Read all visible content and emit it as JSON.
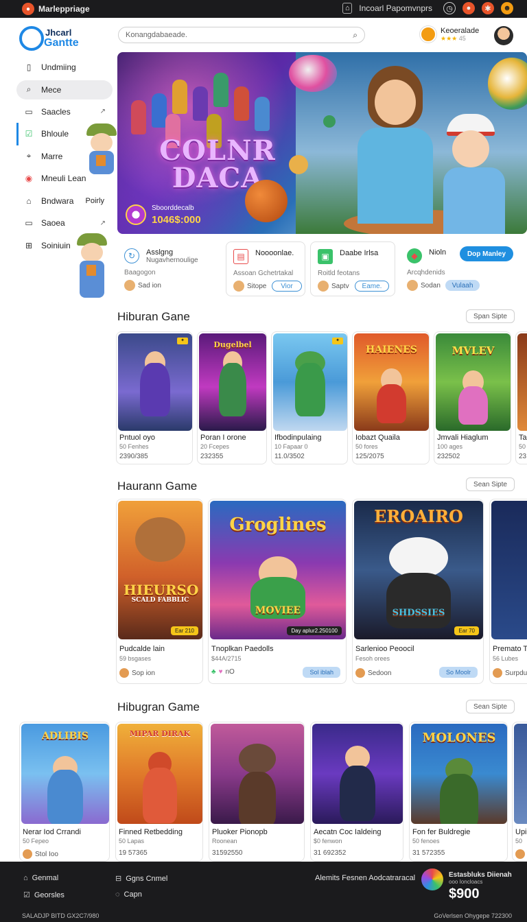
{
  "topbar": {
    "app_title": "Marleppriage",
    "account_text": "Incoarl Papomvnprs"
  },
  "brand": {
    "line1": "Jhcarl",
    "line2": "Gantte"
  },
  "search": {
    "placeholder": "Konangdabaeade."
  },
  "profile": {
    "name": "Keoeralade",
    "rating": "45"
  },
  "sidebar": {
    "items": [
      {
        "label": "Undmiing"
      },
      {
        "label": "Mece"
      },
      {
        "label": "Saacles"
      },
      {
        "label": "Bhloule"
      },
      {
        "label": "Marre"
      },
      {
        "label": "Mneuli Lean"
      },
      {
        "label": "Bndwara",
        "extra": "Poirly"
      },
      {
        "label": "Saoea"
      },
      {
        "label": "Soiniuin"
      }
    ]
  },
  "hero": {
    "title_line1": "COLNR",
    "title_line2": "DACA",
    "prize_label": "Sboorddecalb",
    "prize_value": "1046$:000"
  },
  "categories": [
    {
      "title": "Asslgng",
      "subtitle": "Nugavhernoulige",
      "desc": "Baagogon",
      "mini": "Sad ion"
    },
    {
      "title": "Noooonlae.",
      "desc": "Assoan Gchetrtakal",
      "mini": "Sitope",
      "pill": "Vior"
    },
    {
      "title": "Daabe Irlsa",
      "desc": "Roitld feotans",
      "mini": "Saptv",
      "pill": "Eame."
    },
    {
      "title": "Nioln",
      "desc": "Arcqhdenids",
      "mini": "Sodan",
      "pill": "Vulaah"
    }
  ],
  "download_label": "Dop Manley",
  "sections": [
    {
      "title": "Hiburan Gane",
      "see_all": "Span Sipte"
    },
    {
      "title": "Haurann Game",
      "see_all": "Sean Sipte"
    },
    {
      "title": "Hibugran Game",
      "see_all": "Sean Sipte"
    }
  ],
  "row1": [
    {
      "name": "Pntuol oyo",
      "sub": "50 Fenhes",
      "num": "2390/385"
    },
    {
      "name": "Poran I orone",
      "sub": "20 Fcepes",
      "num": "232355",
      "art": "Dugelbel"
    },
    {
      "name": "Ifbodinpulaing",
      "sub": "10 Fapaar 0",
      "num": "11.0/3502"
    },
    {
      "name": "Iobazt Quaila",
      "sub": "50 fores",
      "num": "125/2075",
      "art": "HAIENES"
    },
    {
      "name": "Jmvali Hiaglum",
      "sub": "100 ages",
      "num": "232502",
      "art": "MVLEV"
    },
    {
      "name": "Ta",
      "sub": "50",
      "num": "23"
    }
  ],
  "row2": [
    {
      "name": "Pudcalde lain",
      "sub": "59 bsgases",
      "mini": "Sop ion",
      "art": "HIEURSO",
      "art2": "SCALD FABBLIC",
      "badge": "Ear 210"
    },
    {
      "name": "Tnoplkan Paedolls",
      "sub": "$44A/2715",
      "mini": "nO",
      "art": "Groglines",
      "art2": "MOVIEE",
      "badge": "Day aplur2.250100",
      "pill": "Sol iblah"
    },
    {
      "name": "Sarlenioo Peoocil",
      "sub": "Fesoh orees",
      "mini": "Sedoon",
      "art": "EROAIRO",
      "art2": "SHDSSIES",
      "badge": "Ear 70",
      "pill": "So Moolr"
    },
    {
      "name": "Premato T",
      "sub": "56 Lubes",
      "mini": "Surpdu"
    }
  ],
  "row3": [
    {
      "name": "Nerar Iod Crrandi",
      "sub": "50 Fepeo",
      "mini": "Stol Ioo",
      "art": "ADLIBIS"
    },
    {
      "name": "Finned Retbedding",
      "sub": "50 Lapas",
      "num": "19 57365",
      "art": "MIPAR DIRAK"
    },
    {
      "name": "Pluoker Pionopb",
      "sub": "Roonean",
      "num": "31592550"
    },
    {
      "name": "Aecatn Coc Ialdeing",
      "sub": "$0 fenwon",
      "num": "31 692352"
    },
    {
      "name": "Fon fer Buldregie",
      "sub": "50 fenoes",
      "num": "31 572355",
      "art": "MOLONES"
    },
    {
      "name": "Upi",
      "sub": "50",
      "mini": ""
    }
  ],
  "footer": {
    "left_items": [
      "Genmal",
      "Georsles"
    ],
    "mid_items": [
      "Ggns Cnmel",
      "Capn"
    ],
    "promo_text": "Alemits Fesnen Aodcatraracal",
    "prize_label": "Estasbluks Diienah",
    "prize_sub": "ooo Ioncloacs",
    "prize_value": "$900",
    "bottom_left": "SALADJP BITD GX2C7/980",
    "bottom_right": "GoVerlsen Ohygepe 722300"
  },
  "colors": {
    "accent": "#1f8fe0",
    "dark": "#1b1b1d",
    "orange": "#e8542a"
  }
}
